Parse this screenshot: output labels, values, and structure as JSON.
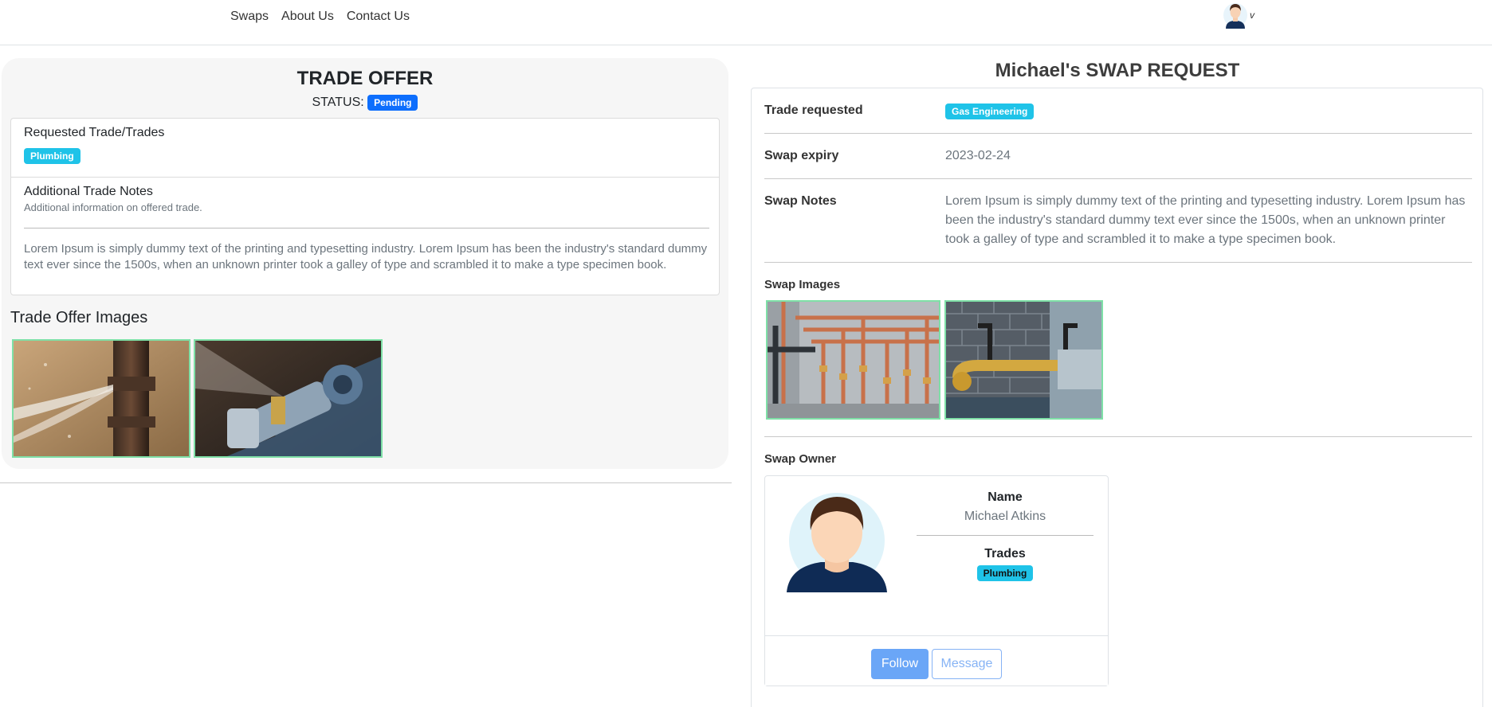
{
  "nav": {
    "links": [
      "Swaps",
      "About Us",
      "Contact Us"
    ],
    "user_caret": "v"
  },
  "trade_offer": {
    "title": "TRADE OFFER",
    "status_label": "STATUS:",
    "status_value": "Pending",
    "requested_heading": "Requested Trade/Trades",
    "requested_trade": "Plumbing",
    "notes_heading": "Additional Trade Notes",
    "notes_subheading": "Additional information on offered trade.",
    "notes_text": "Lorem Ipsum is simply dummy text of the printing and typesetting industry. Lorem Ipsum has been the industry's standard dummy text ever since the 1500s, when an unknown printer took a galley of type and scrambled it to make a type specimen book.",
    "images_title": "Trade Offer Images"
  },
  "swap_request": {
    "title": "Michael's SWAP REQUEST",
    "trade_requested_label": "Trade requested",
    "trade_requested_value": "Gas Engineering",
    "expiry_label": "Swap expiry",
    "expiry_value": "2023-02-24",
    "notes_label": "Swap Notes",
    "notes_value": "Lorem Ipsum is simply dummy text of the printing and typesetting industry. Lorem Ipsum has been the industry's standard dummy text ever since the 1500s, when an unknown printer took a galley of type and scrambled it to make a type specimen book.",
    "images_label": "Swap Images",
    "owner_label": "Swap Owner"
  },
  "owner": {
    "name_label": "Name",
    "name_value": "Michael Atkins",
    "trades_label": "Trades",
    "trades_value": "Plumbing",
    "follow_label": "Follow",
    "message_label": "Message"
  },
  "colors": {
    "primary": "#0d6efd",
    "info": "#1fc3e8",
    "image_border": "#7fe0a7"
  }
}
